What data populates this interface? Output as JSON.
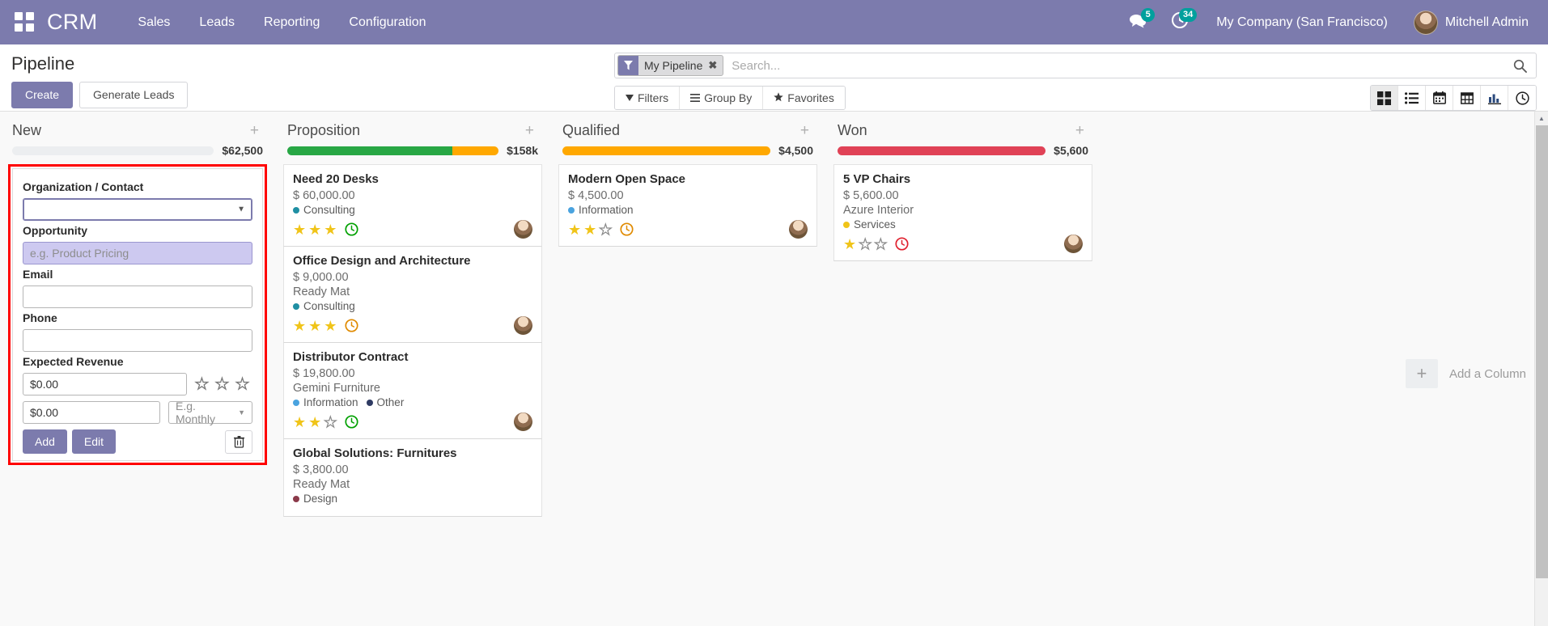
{
  "navbar": {
    "apps_icon": "apps-grid-icon",
    "brand": "CRM",
    "menus": [
      {
        "label": "Sales"
      },
      {
        "label": "Leads"
      },
      {
        "label": "Reporting"
      },
      {
        "label": "Configuration"
      }
    ],
    "messages_icon": "chat-bubble-icon",
    "messages_count": "5",
    "activities_icon": "clock-icon",
    "activities_count": "34",
    "company": "My Company (San Francisco)",
    "user": "Mitchell Admin",
    "avatar_icon": "user-avatar",
    "bg_color": "#7C7BAD"
  },
  "control_panel": {
    "title": "Pipeline",
    "create_label": "Create",
    "generate_leads_label": "Generate Leads",
    "search": {
      "facet_icon": "filter-funnel-icon",
      "facet_label": "My Pipeline",
      "facet_close_icon": "close-x-icon",
      "placeholder": "Search...",
      "value": "",
      "search_icon": "magnifier-icon"
    },
    "filter_buttons": [
      {
        "label": "Filters",
        "icon": "caret-down-filter-icon"
      },
      {
        "label": "Group By",
        "icon": "hamburger-icon"
      },
      {
        "label": "Favorites",
        "icon": "star-icon"
      }
    ],
    "views": [
      {
        "name": "kanban",
        "icon": "kanban-icon",
        "active": true
      },
      {
        "name": "list",
        "icon": "list-icon",
        "active": false
      },
      {
        "name": "calendar",
        "icon": "calendar-icon",
        "active": false
      },
      {
        "name": "pivot",
        "icon": "pivot-table-icon",
        "active": false
      },
      {
        "name": "graph",
        "icon": "bar-chart-icon",
        "active": false
      },
      {
        "name": "activity",
        "icon": "clock-icon",
        "active": false
      }
    ]
  },
  "kanban": {
    "add_column": {
      "plus_icon": "plus-icon",
      "label": "Add a Column"
    },
    "columns": [
      {
        "title": "New",
        "plus_icon": "plus-icon",
        "amount": "$62,500",
        "progress": [],
        "quick_create": {
          "highlighted": true,
          "fields": [
            {
              "label": "Organization / Contact",
              "type": "select",
              "value": "",
              "placeholder": "",
              "state": "focused",
              "caret_icon": "chevron-down-icon"
            },
            {
              "label": "Opportunity",
              "type": "text",
              "value": "",
              "placeholder": "e.g. Product Pricing",
              "state": "highlighted"
            },
            {
              "label": "Email",
              "type": "text",
              "value": "",
              "placeholder": "",
              "state": "normal"
            },
            {
              "label": "Phone",
              "type": "text",
              "value": "",
              "placeholder": "",
              "state": "normal"
            }
          ],
          "revenue_label": "Expected Revenue",
          "revenue_value": "$0.00",
          "recurring_value": "$0.00",
          "recurring_plan_placeholder": "E.g. Monthly",
          "recurring_plan_caret": "chevron-down-icon",
          "priority_stars": 0,
          "priority_max": 3,
          "add_label": "Add",
          "edit_label": "Edit",
          "discard_icon": "trash-icon"
        },
        "cards": []
      },
      {
        "title": "Proposition",
        "plus_icon": "plus-icon",
        "amount": "$158k",
        "progress": [
          {
            "color": "#28a745",
            "percent": 78
          },
          {
            "color": "#FFA800",
            "percent": 22
          }
        ],
        "cards": [
          {
            "title": "Need 20 Desks",
            "amount": "$ 60,000.00",
            "partner": "",
            "tags": [
              {
                "label": "Consulting",
                "color": "#1F8FA3"
              }
            ],
            "stars": 3,
            "stars_max": 3,
            "activity_icon": "clock-icon",
            "activity_color": "#00A000",
            "avatar_icon": "user-avatar"
          },
          {
            "title": "Office Design and Architecture",
            "amount": "$ 9,000.00",
            "partner": "Ready Mat",
            "tags": [
              {
                "label": "Consulting",
                "color": "#1F8FA3"
              }
            ],
            "stars": 3,
            "stars_max": 3,
            "activity_icon": "clock-icon",
            "activity_color": "#E08A00",
            "avatar_icon": "user-avatar"
          },
          {
            "title": "Distributor Contract",
            "amount": "$ 19,800.00",
            "partner": "Gemini Furniture",
            "tags": [
              {
                "label": "Information",
                "color": "#4AA3DF"
              },
              {
                "label": "Other",
                "color": "#2F3B63"
              }
            ],
            "stars": 2,
            "stars_max": 3,
            "activity_icon": "clock-icon",
            "activity_color": "#00A000",
            "avatar_icon": "user-avatar"
          },
          {
            "title": "Global Solutions: Furnitures",
            "amount": "$ 3,800.00",
            "partner": "Ready Mat",
            "tags": [
              {
                "label": "Design",
                "color": "#8B3A4A"
              }
            ],
            "stars": 0,
            "stars_max": 0,
            "activity_icon": "",
            "activity_color": "",
            "avatar_icon": ""
          }
        ]
      },
      {
        "title": "Qualified",
        "plus_icon": "plus-icon",
        "amount": "$4,500",
        "progress": [
          {
            "color": "#FFA800",
            "percent": 100
          }
        ],
        "cards": [
          {
            "title": "Modern Open Space",
            "amount": "$ 4,500.00",
            "partner": "",
            "tags": [
              {
                "label": "Information",
                "color": "#4AA3DF"
              }
            ],
            "stars": 2,
            "stars_max": 3,
            "activity_icon": "clock-icon",
            "activity_color": "#E08A00",
            "avatar_icon": "user-avatar"
          }
        ]
      },
      {
        "title": "Won",
        "plus_icon": "plus-icon",
        "amount": "$5,600",
        "progress": [
          {
            "color": "#E04256",
            "percent": 100
          }
        ],
        "cards": [
          {
            "title": "5 VP Chairs",
            "amount": "$ 5,600.00",
            "partner": "Azure Interior",
            "tags": [
              {
                "label": "Services",
                "color": "#F0C419"
              }
            ],
            "stars": 1,
            "stars_max": 3,
            "activity_icon": "clock-icon",
            "activity_color": "#E0202E",
            "avatar_icon": "user-avatar"
          }
        ]
      }
    ]
  },
  "scrollbar": {
    "up_arrow_icon": "caret-up-icon"
  }
}
